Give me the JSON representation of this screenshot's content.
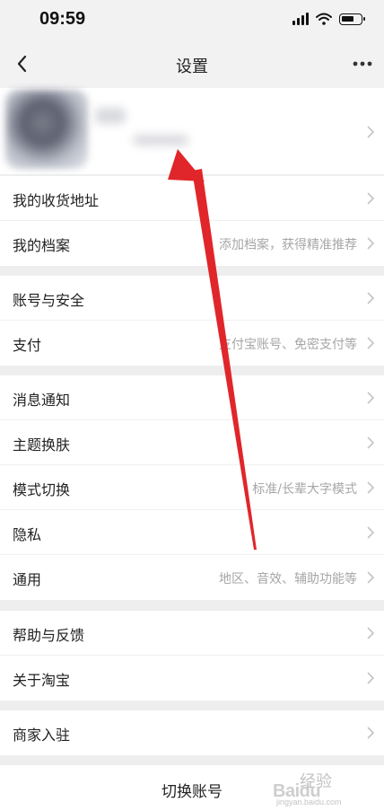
{
  "status_bar": {
    "time": "09:59"
  },
  "nav": {
    "title": "设置"
  },
  "groups": [
    {
      "items": [
        {
          "label": "我的收货地址",
          "hint": ""
        },
        {
          "label": "我的档案",
          "hint": "添加档案，获得精准推荐"
        }
      ]
    },
    {
      "items": [
        {
          "label": "账号与安全",
          "hint": ""
        },
        {
          "label": "支付",
          "hint": "支付宝账号、免密支付等"
        }
      ]
    },
    {
      "items": [
        {
          "label": "消息通知",
          "hint": ""
        },
        {
          "label": "主题换肤",
          "hint": ""
        },
        {
          "label": "模式切换",
          "hint": "标准/长辈大字模式"
        },
        {
          "label": "隐私",
          "hint": ""
        },
        {
          "label": "通用",
          "hint": "地区、音效、辅助功能等"
        }
      ]
    },
    {
      "items": [
        {
          "label": "帮助与反馈",
          "hint": ""
        },
        {
          "label": "关于淘宝",
          "hint": ""
        }
      ]
    },
    {
      "items": [
        {
          "label": "商家入驻",
          "hint": ""
        }
      ]
    }
  ],
  "footer": {
    "switch_account": "切换账号"
  },
  "watermark": {
    "brand": "Baidu",
    "cn": "经验",
    "url": "jingyan.baidu.com"
  },
  "colors": {
    "annotation_arrow": "#e0262a",
    "background": "#eeeeee"
  }
}
